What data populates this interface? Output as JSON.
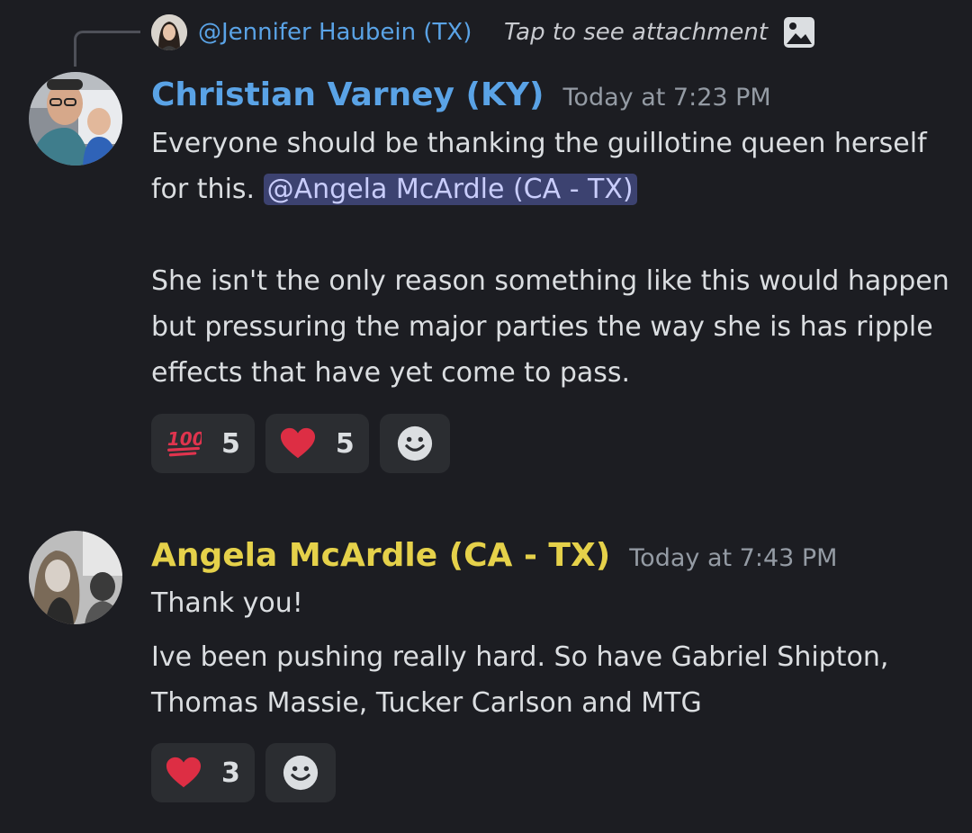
{
  "reply": {
    "author": "@Jennifer Haubein (TX)",
    "text": "Tap to see attachment",
    "icon": "image-icon"
  },
  "messages": [
    {
      "author": "Christian Varney (KY)",
      "author_color": "#5aa3e6",
      "timestamp": "Today at 7:23 PM",
      "text_before_mention": "Everyone should be thanking the guillotine queen herself for this. ",
      "mention": "@Angela McArdle (CA - TX)",
      "paragraph2": "She isn't the only reason something like this would happen but pressuring the major parties the way she is has ripple effects that have yet come to pass.",
      "reactions": [
        {
          "emoji": "hundred-points-icon",
          "count": "5"
        },
        {
          "emoji": "red-heart-icon",
          "count": "5"
        }
      ]
    },
    {
      "author": "Angela McArdle (CA - TX)",
      "author_color": "#e5d14a",
      "timestamp": "Today at 7:43 PM",
      "line1": "Thank you!",
      "line2": "Ive been pushing really hard. So have Gabriel Shipton, Thomas Massie, Tucker Carlson and MTG",
      "reactions": [
        {
          "emoji": "red-heart-icon",
          "count": "3"
        }
      ]
    }
  ],
  "colors": {
    "background": "#1c1d22",
    "reaction_bg": "#2b2d31",
    "mention_bg": "#3c4270",
    "timestamp": "#949ba4"
  }
}
